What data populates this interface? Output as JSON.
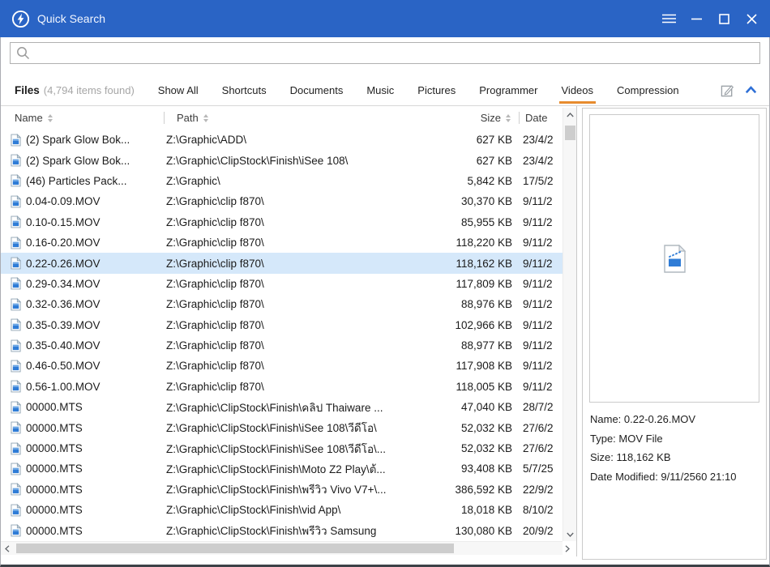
{
  "window": {
    "title": "Quick Search"
  },
  "search": {
    "value": ""
  },
  "tabs": {
    "files_label": "Files",
    "files_count": "(4,794 items found)",
    "items": [
      "Show All",
      "Shortcuts",
      "Documents",
      "Music",
      "Pictures",
      "Programmer",
      "Videos",
      "Compression"
    ],
    "active": "Videos"
  },
  "table": {
    "columns": [
      "Name",
      "Path",
      "Size",
      "Date"
    ],
    "rows": [
      {
        "name": "(2) Spark Glow Bok...",
        "path": "Z:\\Graphic\\ADD\\",
        "size": "627 KB",
        "date": "23/4/2"
      },
      {
        "name": "(2) Spark Glow Bok...",
        "path": "Z:\\Graphic\\ClipStock\\Finish\\iSee 108\\",
        "size": "627 KB",
        "date": "23/4/2"
      },
      {
        "name": "(46) Particles Pack...",
        "path": "Z:\\Graphic\\",
        "size": "5,842 KB",
        "date": "17/5/2"
      },
      {
        "name": "0.04-0.09.MOV",
        "path": "Z:\\Graphic\\clip f870\\",
        "size": "30,370 KB",
        "date": "9/11/2"
      },
      {
        "name": "0.10-0.15.MOV",
        "path": "Z:\\Graphic\\clip f870\\",
        "size": "85,955 KB",
        "date": "9/11/2"
      },
      {
        "name": "0.16-0.20.MOV",
        "path": "Z:\\Graphic\\clip f870\\",
        "size": "118,220 KB",
        "date": "9/11/2"
      },
      {
        "name": "0.22-0.26.MOV",
        "path": "Z:\\Graphic\\clip f870\\",
        "size": "118,162 KB",
        "date": "9/11/2",
        "selected": true
      },
      {
        "name": "0.29-0.34.MOV",
        "path": "Z:\\Graphic\\clip f870\\",
        "size": "117,809 KB",
        "date": "9/11/2"
      },
      {
        "name": "0.32-0.36.MOV",
        "path": "Z:\\Graphic\\clip f870\\",
        "size": "88,976 KB",
        "date": "9/11/2"
      },
      {
        "name": "0.35-0.39.MOV",
        "path": "Z:\\Graphic\\clip f870\\",
        "size": "102,966 KB",
        "date": "9/11/2"
      },
      {
        "name": "0.35-0.40.MOV",
        "path": "Z:\\Graphic\\clip f870\\",
        "size": "88,977 KB",
        "date": "9/11/2"
      },
      {
        "name": "0.46-0.50.MOV",
        "path": "Z:\\Graphic\\clip f870\\",
        "size": "117,908 KB",
        "date": "9/11/2"
      },
      {
        "name": "0.56-1.00.MOV",
        "path": "Z:\\Graphic\\clip f870\\",
        "size": "118,005 KB",
        "date": "9/11/2"
      },
      {
        "name": "00000.MTS",
        "path": "Z:\\Graphic\\ClipStock\\Finish\\คลิป Thaiware ...",
        "size": "47,040 KB",
        "date": "28/7/2"
      },
      {
        "name": "00000.MTS",
        "path": "Z:\\Graphic\\ClipStock\\Finish\\iSee 108\\วีดีโอ\\",
        "size": "52,032 KB",
        "date": "27/6/2"
      },
      {
        "name": "00000.MTS",
        "path": "Z:\\Graphic\\ClipStock\\Finish\\iSee 108\\วีดีโอ\\...",
        "size": "52,032 KB",
        "date": "27/6/2"
      },
      {
        "name": "00000.MTS",
        "path": "Z:\\Graphic\\ClipStock\\Finish\\Moto Z2 Play\\ต้...",
        "size": "93,408 KB",
        "date": "5/7/25"
      },
      {
        "name": "00000.MTS",
        "path": "Z:\\Graphic\\ClipStock\\Finish\\พรีวิว Vivo V7+\\...",
        "size": "386,592 KB",
        "date": "22/9/2"
      },
      {
        "name": "00000.MTS",
        "path": "Z:\\Graphic\\ClipStock\\Finish\\vid App\\",
        "size": "18,018 KB",
        "date": "8/10/2"
      },
      {
        "name": "00000.MTS",
        "path": "Z:\\Graphic\\ClipStock\\Finish\\พรีวิว Samsung",
        "size": "130,080 KB",
        "date": "20/9/2"
      }
    ]
  },
  "details": {
    "lines": [
      "Name: 0.22-0.26.MOV",
      "Type: MOV File",
      "Size: 118,162 KB",
      "Date Modified: 9/11/2560 21:10"
    ]
  },
  "icons": {
    "logo": "lightning-bolt-in-circle",
    "search": "magnifier",
    "edit_tabs": "pencil-in-box",
    "collapse": "chevron-up",
    "row_file": "video-document",
    "preview_file": "video-document-large"
  },
  "colors": {
    "titlebar": "#2a64c5",
    "active_tab_underline": "#e78b2e",
    "selected_row": "#d5e8fa",
    "file_icon_blue": "#2f7cd6"
  }
}
